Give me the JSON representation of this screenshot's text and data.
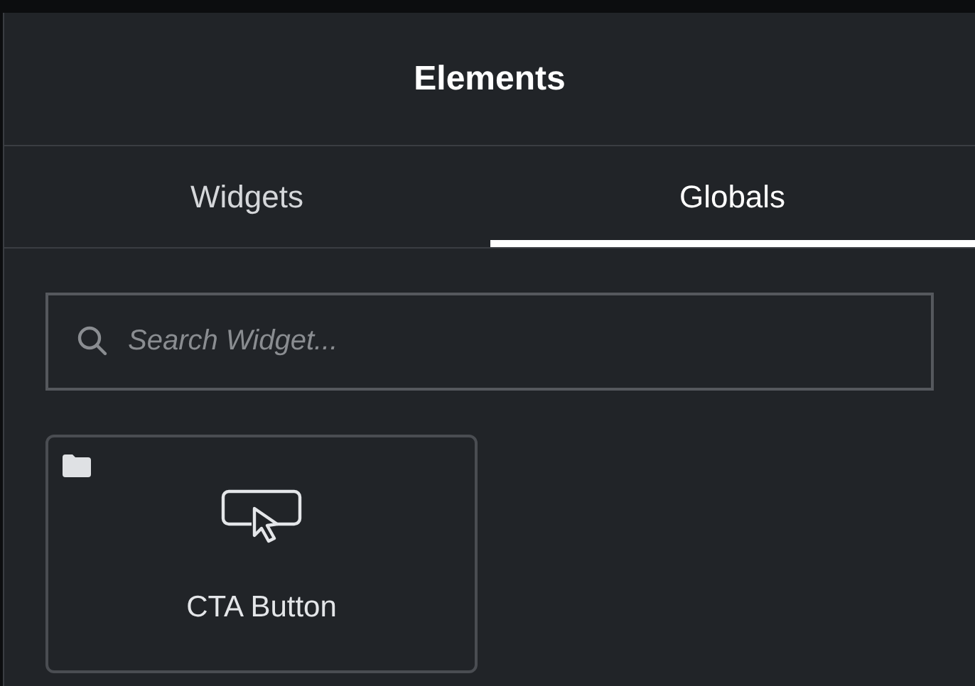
{
  "panel": {
    "title": "Elements"
  },
  "tabs": [
    {
      "label": "Widgets",
      "selected": false
    },
    {
      "label": "Globals",
      "selected": true
    }
  ],
  "search": {
    "placeholder": "Search Widget..."
  },
  "widgets": [
    {
      "label": "CTA Button",
      "in_folder": true
    }
  ]
}
